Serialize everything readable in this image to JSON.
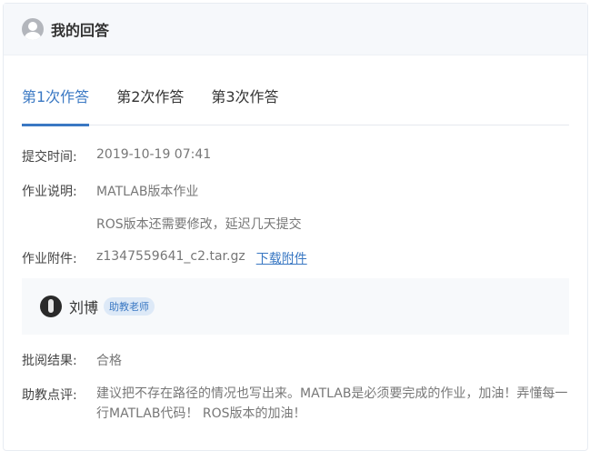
{
  "header": {
    "title": "我的回答",
    "avatar_icon": "user-avatar-icon"
  },
  "tabs": [
    {
      "label": "第1次作答",
      "active": true
    },
    {
      "label": "第2次作答",
      "active": false
    },
    {
      "label": "第3次作答",
      "active": false
    }
  ],
  "submission": {
    "time_label": "提交时间:",
    "time_value": "2019-10-19 07:41",
    "desc_label": "作业说明:",
    "desc_line1": "MATLAB版本作业",
    "desc_line2": "ROS版本还需要修改，延迟几天提交",
    "attach_label": "作业附件:",
    "attach_filename": "z1347559641_c2.tar.gz",
    "attach_download": "下载附件"
  },
  "teacher": {
    "name": "刘博",
    "badge": "助教老师"
  },
  "review": {
    "result_label": "批阅结果:",
    "result_value": "合格",
    "comment_label": "助教点评:",
    "comment_value": "建议把不存在路径的情况也写出来。MATLAB是必须要完成的作业，加油！弄懂每一行MATLAB代码！ ROS版本的加油！"
  },
  "colors": {
    "accent": "#3a78c3",
    "header_bg": "#f6f8fb",
    "teacher_bg": "#f7f9fb"
  }
}
